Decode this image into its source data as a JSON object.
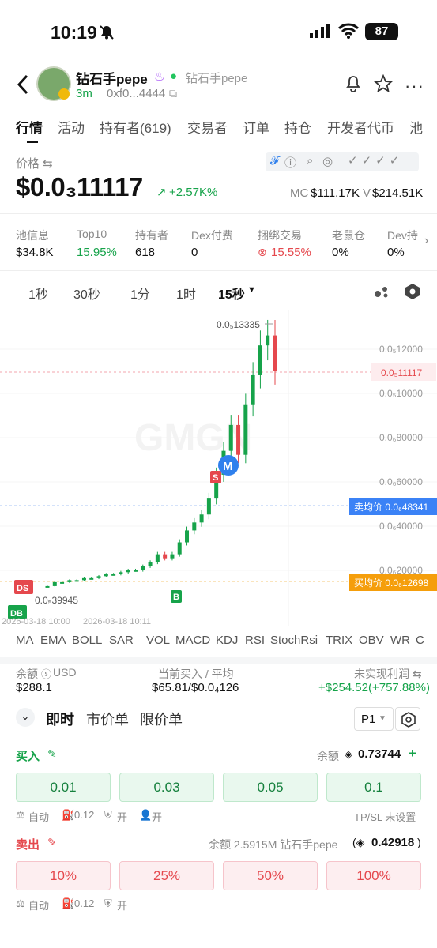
{
  "status": {
    "time": "10:19",
    "battery": "87"
  },
  "token": {
    "name": "钻石手pepe",
    "alt_name": "钻石手pepe",
    "age": "3m",
    "address": "0xf0...4444"
  },
  "tabs": [
    "行情",
    "活动",
    "持有者(619)",
    "交易者",
    "订单",
    "持仓",
    "开发者代币",
    "池"
  ],
  "price": {
    "label": "价格 ⇆",
    "main": "$0.0₃11117",
    "change": "+2.57K%",
    "mc_label": "MC",
    "mc": "$111.17K",
    "v_label": "V",
    "v": "$214.51K"
  },
  "stats": [
    {
      "label": "池信息",
      "value": "$34.8K"
    },
    {
      "label": "Top10",
      "value": "15.95%"
    },
    {
      "label": "持有者",
      "value": "618"
    },
    {
      "label": "Dex付费",
      "value": "0"
    },
    {
      "label": "捆绑交易",
      "value": "15.55%"
    },
    {
      "label": "老鼠仓",
      "value": "0%"
    },
    {
      "label": "Dev持",
      "value": "0%"
    }
  ],
  "timeframes": [
    "1秒",
    "30秒",
    "1分",
    "1时",
    "15秒"
  ],
  "chart": {
    "high_label": "0.0₅13335",
    "low_label": "0.0₅39945",
    "y_ticks": [
      "0.0₅12000",
      "0.0₅10000",
      "0.0₆80000",
      "0.0₆60000",
      "0.0₆40000",
      "0.0₆20000"
    ],
    "current_price": "0.0₅11117",
    "avg_sell_price": "卖均价 0.0₆48341",
    "avg_buy_price": "买均价 0.0₆12698",
    "x_labels": [
      "2026-03-18 10:00",
      "2026-03-18 10:11"
    ],
    "watermark": "GMGN",
    "markers": {
      "m": "M",
      "s": "S",
      "b": "B",
      "ds": "DS",
      "db": "DB"
    }
  },
  "chart_data": {
    "type": "candlestick",
    "title": "",
    "y_ticks": [
      "0.0₅12000",
      "0.0₅10000",
      "0.0₆80000",
      "0.0₆60000",
      "0.0₆40000",
      "0.0₆20000"
    ],
    "x_labels": [
      "2026-03-18 10:00",
      "2026-03-18 10:11"
    ],
    "series_close": [
      0.04,
      0.06,
      0.06,
      0.07,
      0.07,
      0.08,
      0.08,
      0.09,
      0.1,
      0.1,
      0.11,
      0.12,
      0.12,
      0.14,
      0.16,
      0.2,
      0.18,
      0.2,
      0.26,
      0.32,
      0.36,
      0.4,
      0.48,
      0.6,
      0.72,
      0.85,
      0.7,
      0.95,
      1.1,
      1.25,
      1.3,
      1.12
    ],
    "ylim": [
      0,
      1.35
    ]
  },
  "indicators": [
    "MA",
    "EMA",
    "BOLL",
    "SAR",
    "VOL",
    "MACD",
    "KDJ",
    "RSI",
    "StochRsi",
    "TRIX",
    "OBV",
    "WR",
    "C"
  ],
  "balance": {
    "label": "余额",
    "unit": "USD",
    "value": "$288.1",
    "buy_label": "当前买入 / 平均",
    "buy_value": "$65.81/$0.0₄126",
    "pnl_label": "未实现利润 ⇆",
    "pnl_value": "+$254.52(+757.88%)"
  },
  "order_tabs": [
    "即时",
    "市价单",
    "限价单"
  ],
  "preset": "P1",
  "buy": {
    "label": "买入",
    "balance_label": "余额",
    "balance": "0.73744",
    "amounts": [
      "0.01",
      "0.03",
      "0.05",
      "0.1"
    ],
    "opt_auto": "自动",
    "opt_fee": "0.12",
    "opt_on1": "开",
    "opt_on2": "开",
    "tpsl": "TP/SL 未设置"
  },
  "sell": {
    "label": "卖出",
    "balance_text": "余额 2.5915M 钻石手pepe",
    "balance_value": "0.42918",
    "amounts": [
      "10%",
      "25%",
      "50%",
      "100%"
    ],
    "opt_auto": "自动",
    "opt_fee": "0.12",
    "opt_on": "开"
  },
  "colors": {
    "up": "#16a34a",
    "down": "#e5484d",
    "accent_blue": "#2f80ed",
    "sell_avg": "#3b82f6",
    "buy_avg": "#f59e0b"
  }
}
